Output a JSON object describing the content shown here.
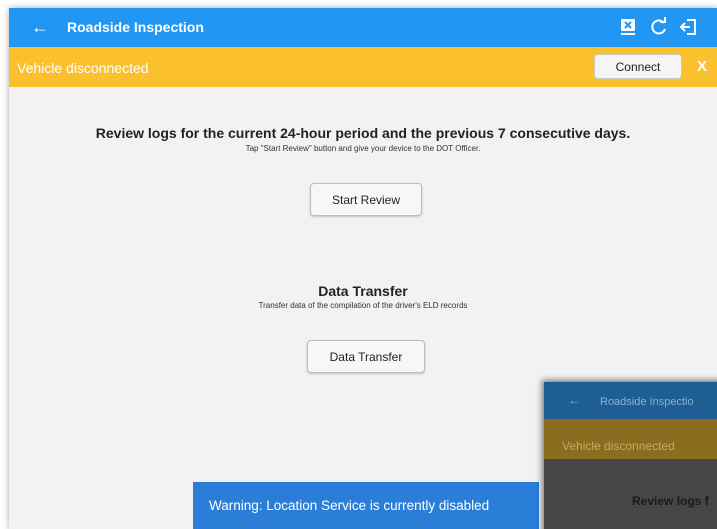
{
  "app_bar": {
    "back_icon": "arrow-left-icon",
    "title": "Roadside Inspection",
    "action_icons": [
      "device-disconnect-icon",
      "refresh-icon",
      "logout-icon"
    ]
  },
  "banner": {
    "status_text": "Vehicle disconnected",
    "connect_label": "Connect",
    "close_label": "X"
  },
  "review": {
    "heading": "Review logs for the current 24-hour period and the previous 7 consecutive days.",
    "subtext": "Tap \"Start Review\" button and give your device to the DOT Officer.",
    "button_label": "Start Review"
  },
  "transfer": {
    "heading": "Data Transfer",
    "subtext": "Transfer data of the compilation of the driver's ELD records",
    "button_label": "Data Transfer"
  },
  "toast": {
    "message": "Warning: Location Service is currently disabled"
  },
  "overlay_preview": {
    "title": "Roadside Inspectio",
    "banner_text": "Vehicle disconnected",
    "body_text": "Review logs f"
  },
  "colors": {
    "primary": "#2196f3",
    "banner": "#fbc02d",
    "toast": "#2a7ed8"
  }
}
